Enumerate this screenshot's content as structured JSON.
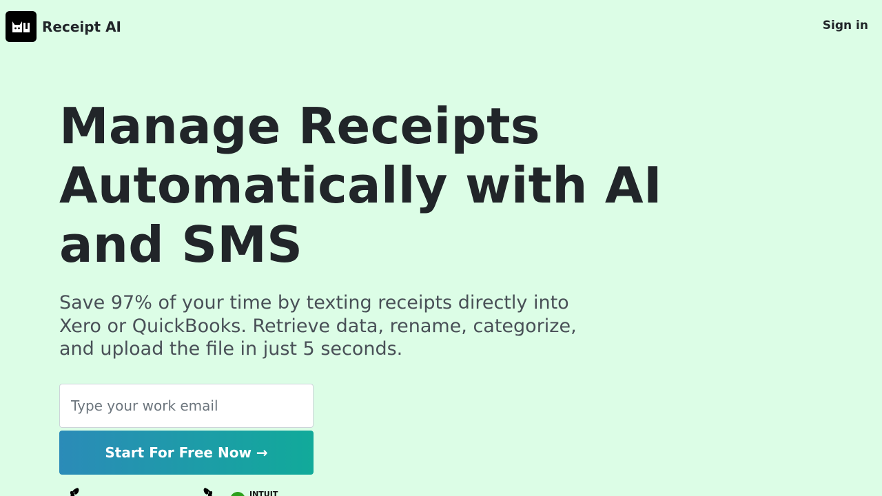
{
  "header": {
    "brand_name": "Receipt AI",
    "logo_icon": "cat-face-icon",
    "signin_label": "Sign in"
  },
  "hero": {
    "headline_line1": "Manage Receipts",
    "headline_line2": "Automatically with AI",
    "headline_line3": "and SMS",
    "subtext_line1": "Save 97% of your time by texting receipts directly into",
    "subtext_line2": "Xero or QuickBooks. Retrieve data, rename, categorize,",
    "subtext_line3": "and upload the file in just 5 seconds."
  },
  "signup": {
    "email_placeholder": "Type your work email",
    "email_value": "",
    "cta_label": "Start For Free Now →"
  },
  "badges": {
    "intuit_label": "INTUIT"
  },
  "colors": {
    "background": "#dcfde6",
    "text": "#212529",
    "subtext": "#495057",
    "cta_gradient_start": "#2b8bb8",
    "cta_gradient_end": "#11aa9a"
  }
}
